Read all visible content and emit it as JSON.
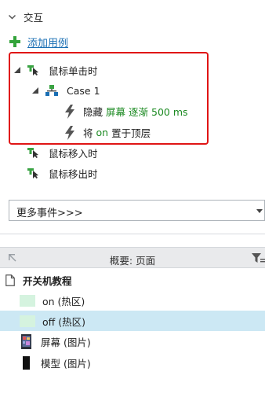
{
  "interactions": {
    "section_title": "交互",
    "add_case_label": "添加用例",
    "events": [
      {
        "label": "鼠标单击时"
      },
      {
        "label": "鼠标移入时"
      },
      {
        "label": "鼠标移出时"
      }
    ],
    "case": {
      "label": "Case 1"
    },
    "actions": {
      "hide": {
        "verb": "隐藏",
        "target": "屏幕",
        "effect": "逐渐 500 ms"
      },
      "bring_front": {
        "prefix": "将",
        "target": "on",
        "verb": "置于顶层"
      }
    },
    "more_events": {
      "selected": "更多事件>>>"
    }
  },
  "outline": {
    "title": "概要: 页面",
    "page_name": "开关机教程",
    "items": [
      {
        "label": "on (热区)"
      },
      {
        "label": "off (热区)"
      },
      {
        "label": "屏幕 (图片)"
      },
      {
        "label": "模型 (图片)"
      }
    ]
  },
  "colors": {
    "accent_link": "#1a6fb4",
    "action_target_green": "#1c8a22",
    "highlight_red": "#e01515",
    "selection_blue": "#cce8f4",
    "hotspot_swatch": "#d5f3df"
  }
}
